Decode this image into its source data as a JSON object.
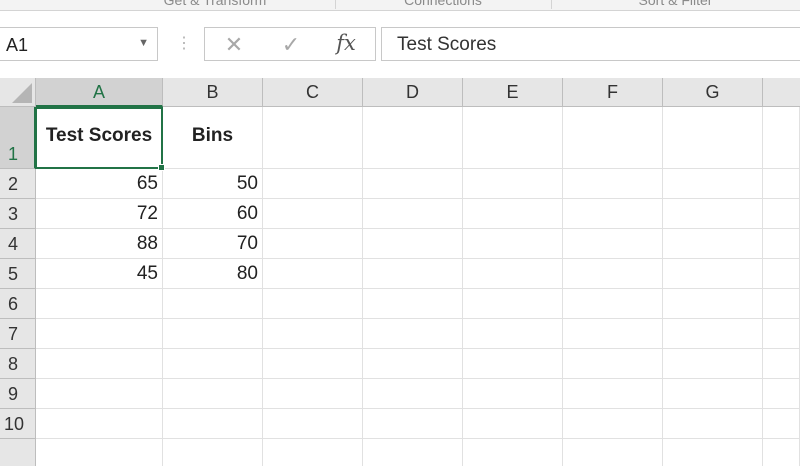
{
  "ribbon": {
    "groups": [
      "Get & Transform",
      "Connections",
      "Sort & Filter"
    ]
  },
  "formula_bar": {
    "name_box": "A1",
    "name_box_icon": "dropdown-arrow-icon",
    "separator_icon": "vertical-dots-icon",
    "cancel_icon": "cross-icon",
    "enter_icon": "checkmark-icon",
    "function_icon": "fx-icon",
    "cancel_glyph": "✕",
    "enter_glyph": "✓",
    "function_glyph": "fx",
    "content": "Test Scores"
  },
  "sheet": {
    "columns": [
      "A",
      "B",
      "C",
      "D",
      "E",
      "F",
      "G"
    ],
    "rows": [
      "1",
      "2",
      "3",
      "4",
      "5",
      "6",
      "7",
      "8",
      "9",
      "10"
    ],
    "selected_cell": "A1",
    "accent_color": "#217346",
    "cells": {
      "A1": "Test Scores",
      "B1": "Bins",
      "A2": "65",
      "B2": "50",
      "A3": "72",
      "B3": "60",
      "A4": "88",
      "B4": "70",
      "A5": "45",
      "B5": "80"
    }
  }
}
